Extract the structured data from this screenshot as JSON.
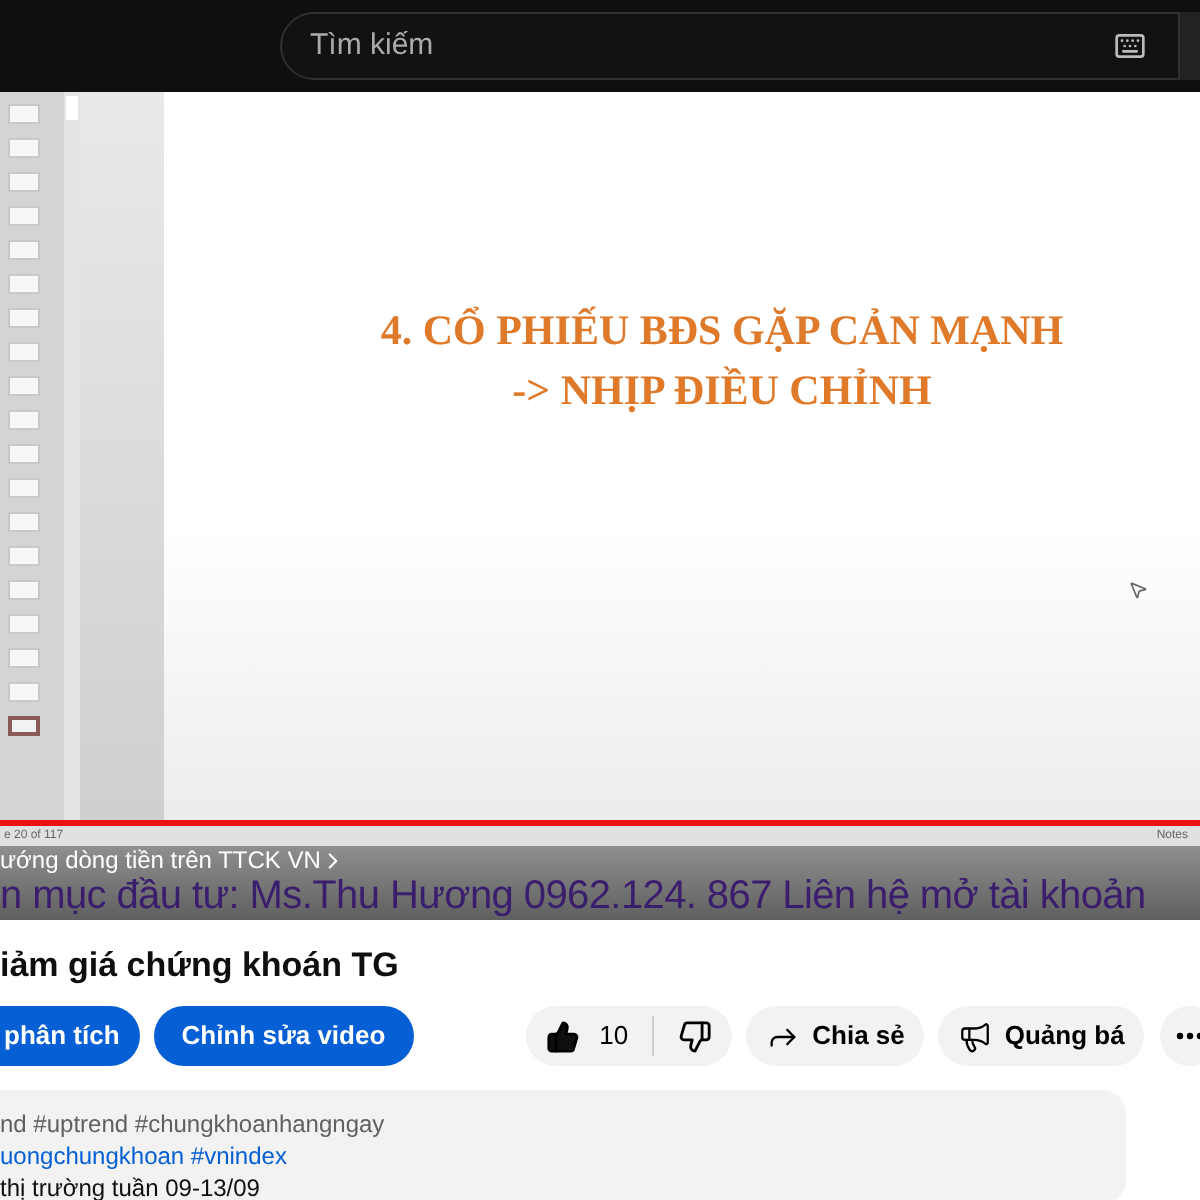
{
  "search": {
    "placeholder": "Tìm kiếm"
  },
  "video": {
    "slide": {
      "lines": [
        "4. CỔ PHIẾU BĐS GẶP CẢN MẠNH",
        "-> NHỊP ĐIỀU CHỈNH"
      ]
    },
    "thumbnails": [
      {
        "selected": false
      },
      {
        "selected": false
      },
      {
        "selected": false
      },
      {
        "selected": false
      },
      {
        "selected": false
      },
      {
        "selected": false
      },
      {
        "selected": false
      },
      {
        "selected": false
      },
      {
        "selected": false
      },
      {
        "selected": false
      },
      {
        "selected": false
      },
      {
        "selected": false
      },
      {
        "selected": false
      },
      {
        "selected": false
      },
      {
        "selected": false
      },
      {
        "selected": false
      },
      {
        "selected": false
      },
      {
        "selected": false
      },
      {
        "selected": true
      }
    ],
    "status_left": "e 20 of 117",
    "status_right": "Notes",
    "progress": {
      "level": 1
    },
    "chapter": "ướng dòng tiền trên TTCK VN",
    "ticker": "n mục đầu tư: Ms.Thu Hương 0962.124. 867  Liên hệ mở tài khoản"
  },
  "title": "iảm giá chứng khoán TG",
  "buttons": [
    "phân tích",
    "Chỉnh sửa video"
  ],
  "likes": "10",
  "actions": [
    {
      "kind": "share",
      "label": "Chia sẻ"
    },
    {
      "kind": "promote",
      "label": "Quảng bá"
    }
  ],
  "description": [
    {
      "kind": "plain",
      "text": "nd #uptrend #chungkhoanhangngay"
    },
    {
      "kind": "link",
      "text": "uongchungkhoan #vnindex"
    },
    {
      "kind": "plain",
      "text": "thị trường tuần 09-13/09"
    }
  ]
}
